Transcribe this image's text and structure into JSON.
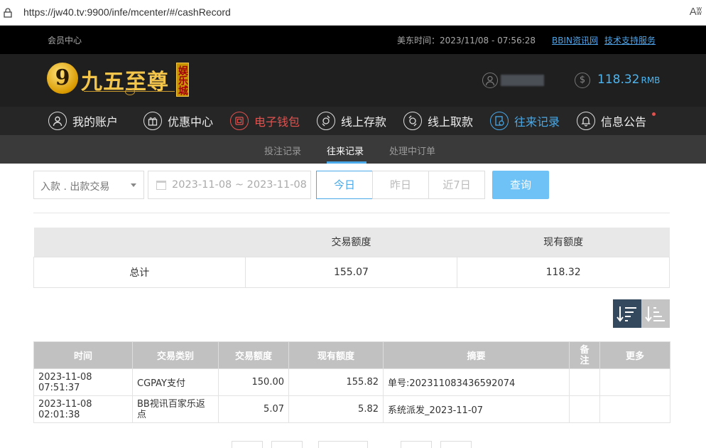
{
  "browser": {
    "url": "https://jw40.tv:9900/infe/mcenter/#/cashRecord",
    "reader_label": "Aʬ"
  },
  "topbar": {
    "member_center": "会员中心",
    "time_label": "美东时间：2023/11/08 - 07:56:28",
    "link_news": "BBIN资讯网",
    "link_support": "技术支持服务"
  },
  "header": {
    "logo_digit": "9",
    "logo_text": "九五至尊",
    "logo_tag": "娱乐城",
    "balance": "118.32",
    "currency": "RMB"
  },
  "nav": [
    {
      "label": "我的账户",
      "icon": "user-icon"
    },
    {
      "label": "优惠中心",
      "icon": "gift-icon"
    },
    {
      "label": "电子钱包",
      "icon": "wallet-icon"
    },
    {
      "label": "线上存款",
      "icon": "deposit-icon"
    },
    {
      "label": "线上取款",
      "icon": "withdraw-icon"
    },
    {
      "label": "往来记录",
      "icon": "records-icon"
    },
    {
      "label": "信息公告",
      "icon": "bell-icon"
    }
  ],
  "subnav": [
    "投注记录",
    "往来记录",
    "处理中订单"
  ],
  "filters": {
    "type_select": "入款 . 出款交易",
    "date_range": "2023-11-08 ~ 2023-11-08",
    "today": "今日",
    "yesterday": "昨日",
    "last7": "近7日",
    "search": "查询"
  },
  "summary": {
    "headers": [
      "",
      "交易额度",
      "现有额度"
    ],
    "row": [
      "总计",
      "155.07",
      "118.32"
    ]
  },
  "records": {
    "headers": [
      "时间",
      "交易类别",
      "交易额度",
      "现有额度",
      "摘要",
      "备注",
      "更多"
    ],
    "rows": [
      [
        "2023-11-08 07:51:37",
        "CGPAY支付",
        "150.00",
        "155.82",
        "单号:202311083436592074",
        "",
        ""
      ],
      [
        "2023-11-08 02:01:38",
        "BB视讯百家乐返点",
        "5.07",
        "5.82",
        "系统派发_2023-11-07",
        "",
        ""
      ]
    ]
  },
  "colors": {
    "accent": "#49a9e9",
    "red": "#e0524f",
    "gold": "#f3c54a",
    "balance": "#4fb5ee"
  }
}
